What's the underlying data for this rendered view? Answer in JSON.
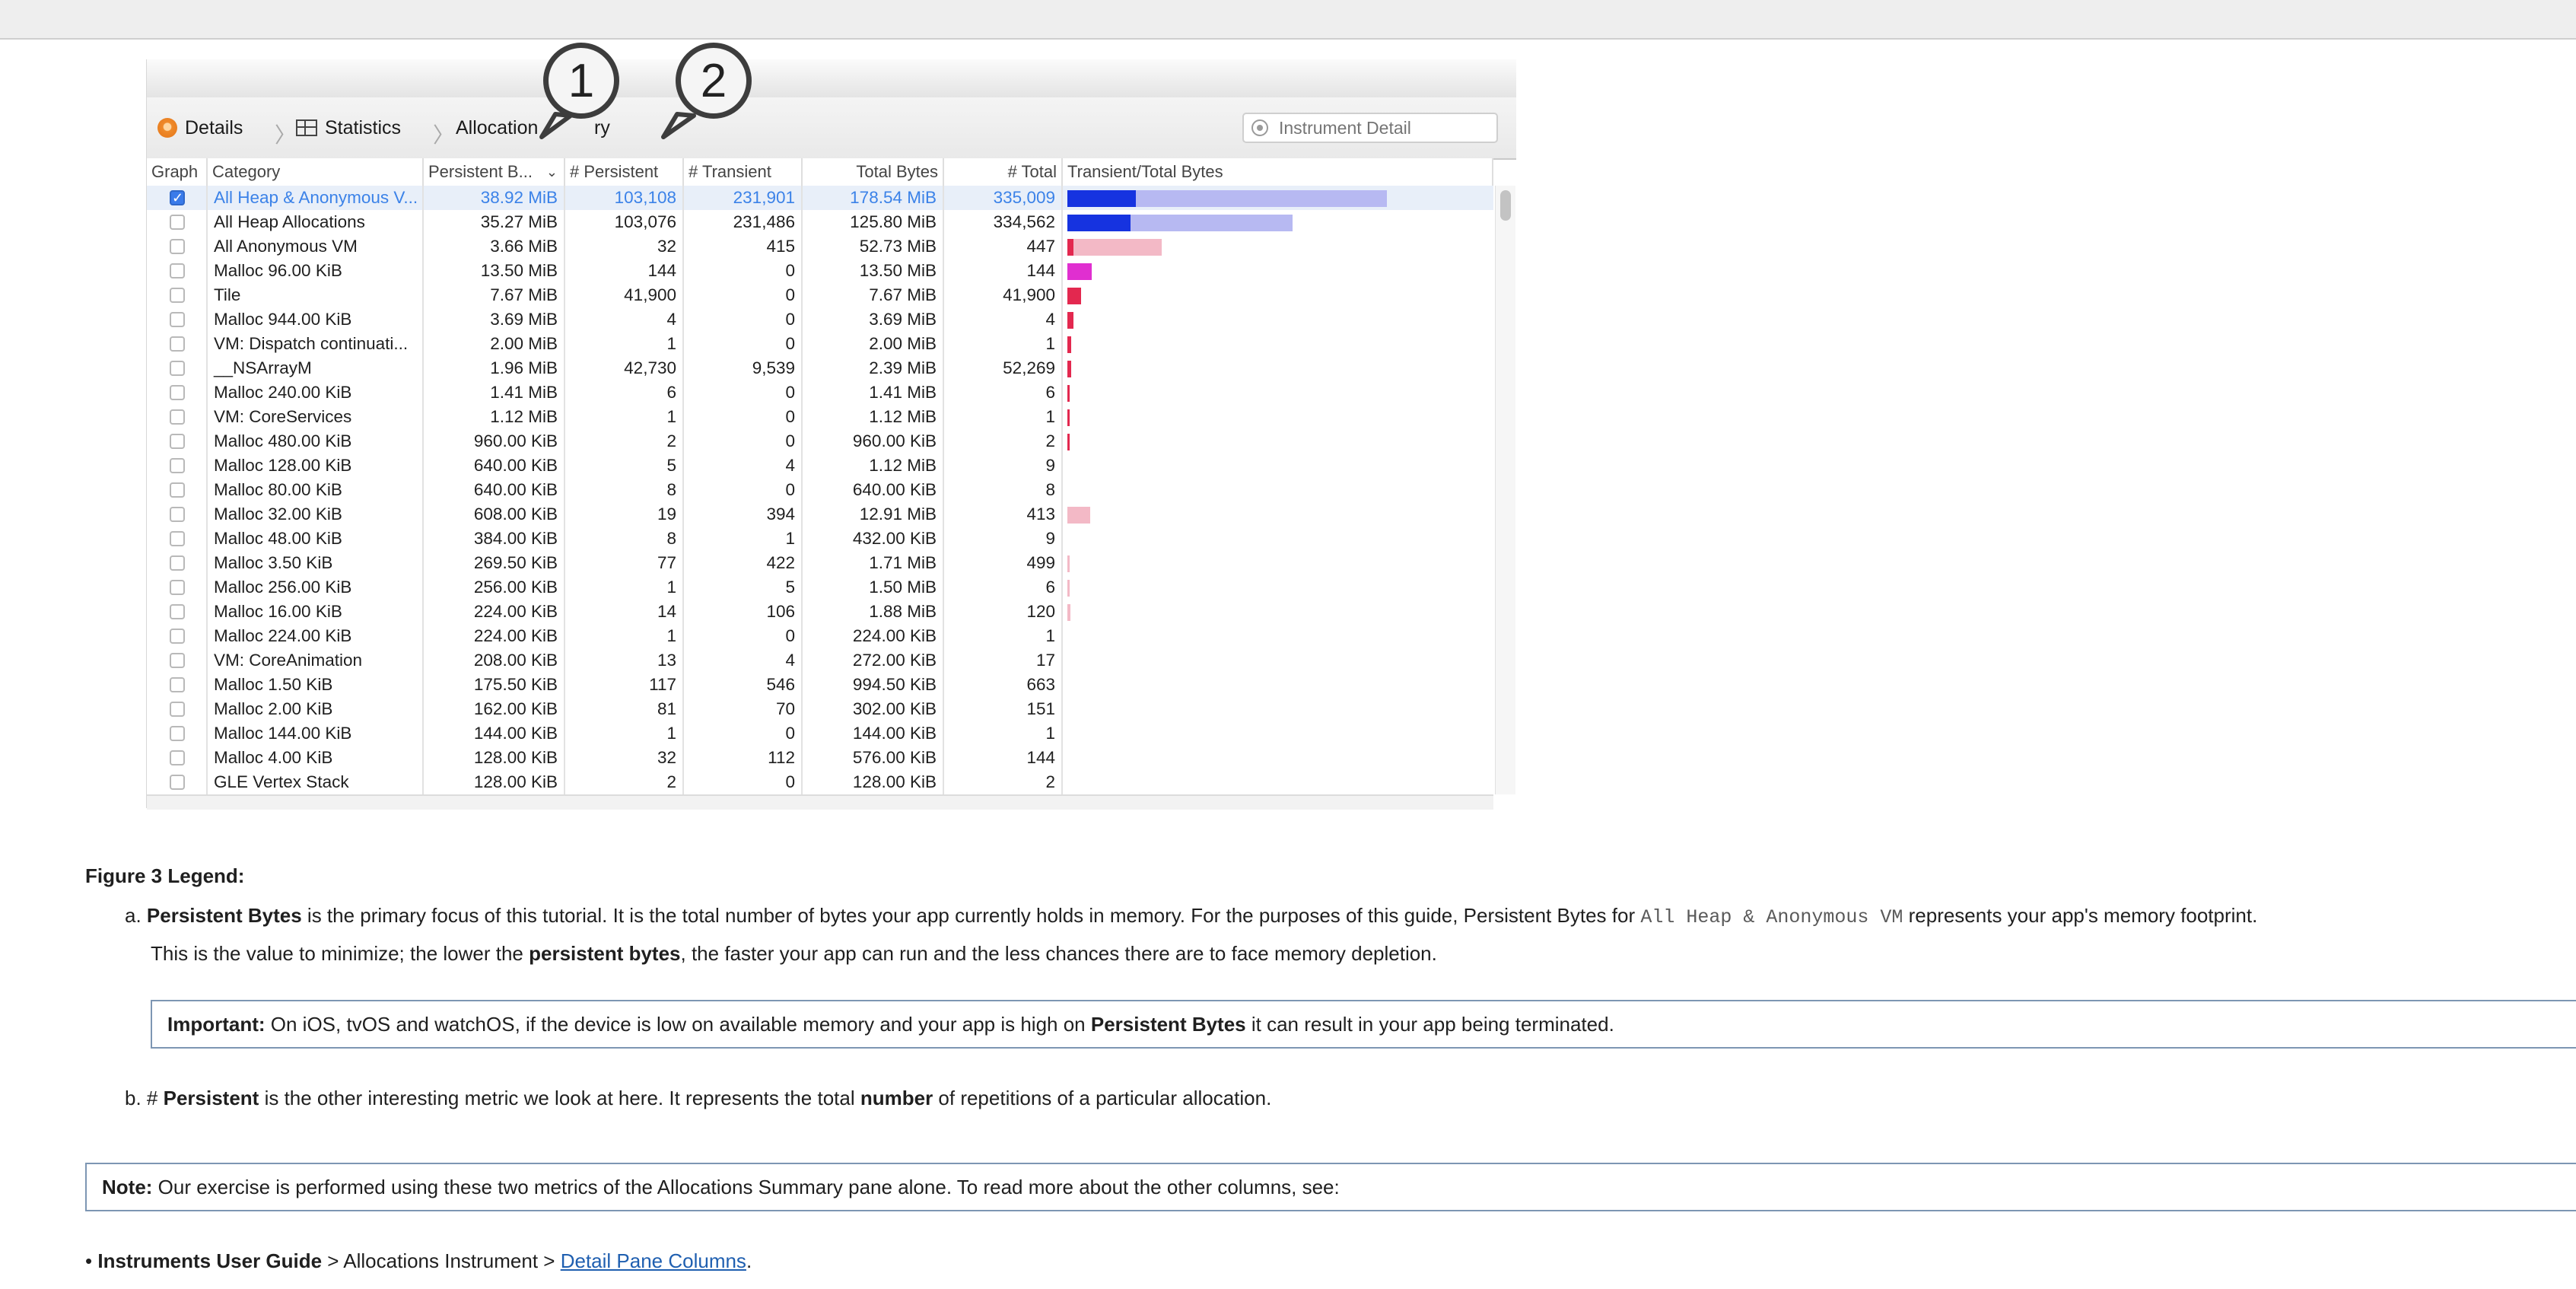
{
  "toolbar": {
    "crumbs": [
      "Details",
      "Statistics",
      "Allocation",
      "ry"
    ],
    "search_placeholder": "Instrument Detail"
  },
  "table": {
    "columns": [
      "Graph",
      "Category",
      "Persistent B...",
      "# Persistent",
      "# Transient",
      "Total Bytes",
      "# Total",
      "Transient/Total Bytes"
    ],
    "rows": [
      {
        "checked": true,
        "selected": true,
        "category": "All Heap & Anonymous V...",
        "persistent_bytes": "38.92 MiB",
        "persistent": "103,108",
        "transient": "231,901",
        "total_bytes": "178.54 MiB",
        "total": "335,009",
        "bar_solid": 0.215,
        "bar_light": 1.0,
        "bar_color": "#1633e0",
        "bar_light_color": "#b7b9f2"
      },
      {
        "checked": false,
        "selected": false,
        "category": "All Heap Allocations",
        "persistent_bytes": "35.27 MiB",
        "persistent": "103,076",
        "transient": "231,486",
        "total_bytes": "125.80 MiB",
        "total": "334,562",
        "bar_solid": 0.197,
        "bar_light": 0.705,
        "bar_color": "#1633e0",
        "bar_light_color": "#b7b9f2"
      },
      {
        "checked": false,
        "selected": false,
        "category": "All Anonymous VM",
        "persistent_bytes": "3.66 MiB",
        "persistent": "32",
        "transient": "415",
        "total_bytes": "52.73 MiB",
        "total": "447",
        "bar_solid": 0.02,
        "bar_light": 0.295,
        "bar_color": "#e3284f",
        "bar_light_color": "#f3b9c6"
      },
      {
        "checked": false,
        "selected": false,
        "category": "Malloc 96.00 KiB",
        "persistent_bytes": "13.50 MiB",
        "persistent": "144",
        "transient": "0",
        "total_bytes": "13.50 MiB",
        "total": "144",
        "bar_solid": 0.075,
        "bar_light": 0.075,
        "bar_color": "#e02fd0",
        "bar_light_color": "#e02fd0"
      },
      {
        "checked": false,
        "selected": false,
        "category": "Tile",
        "persistent_bytes": "7.67 MiB",
        "persistent": "41,900",
        "transient": "0",
        "total_bytes": "7.67 MiB",
        "total": "41,900",
        "bar_solid": 0.043,
        "bar_light": 0.043,
        "bar_color": "#e3284f",
        "bar_light_color": "#e3284f"
      },
      {
        "checked": false,
        "selected": false,
        "category": "Malloc 944.00 KiB",
        "persistent_bytes": "3.69 MiB",
        "persistent": "4",
        "transient": "0",
        "total_bytes": "3.69 MiB",
        "total": "4",
        "bar_solid": 0.02,
        "bar_light": 0.02,
        "bar_color": "#e3284f",
        "bar_light_color": "#e3284f"
      },
      {
        "checked": false,
        "selected": false,
        "category": "VM: Dispatch continuati...",
        "persistent_bytes": "2.00 MiB",
        "persistent": "1",
        "transient": "0",
        "total_bytes": "2.00 MiB",
        "total": "1",
        "bar_solid": 0.011,
        "bar_light": 0.011,
        "bar_color": "#e3284f",
        "bar_light_color": "#e3284f"
      },
      {
        "checked": false,
        "selected": false,
        "category": "__NSArrayM",
        "persistent_bytes": "1.96 MiB",
        "persistent": "42,730",
        "transient": "9,539",
        "total_bytes": "2.39 MiB",
        "total": "52,269",
        "bar_solid": 0.011,
        "bar_light": 0.013,
        "bar_color": "#e3284f",
        "bar_light_color": "#f3b9c6"
      },
      {
        "checked": false,
        "selected": false,
        "category": "Malloc 240.00 KiB",
        "persistent_bytes": "1.41 MiB",
        "persistent": "6",
        "transient": "0",
        "total_bytes": "1.41 MiB",
        "total": "6",
        "bar_solid": 0.008,
        "bar_light": 0.008,
        "bar_color": "#e3284f",
        "bar_light_color": "#e3284f"
      },
      {
        "checked": false,
        "selected": false,
        "category": "VM: CoreServices",
        "persistent_bytes": "1.12 MiB",
        "persistent": "1",
        "transient": "0",
        "total_bytes": "1.12 MiB",
        "total": "1",
        "bar_solid": 0.006,
        "bar_light": 0.006,
        "bar_color": "#e3284f",
        "bar_light_color": "#e3284f"
      },
      {
        "checked": false,
        "selected": false,
        "category": "Malloc 480.00 KiB",
        "persistent_bytes": "960.00 KiB",
        "persistent": "2",
        "transient": "0",
        "total_bytes": "960.00 KiB",
        "total": "2",
        "bar_solid": 0.005,
        "bar_light": 0.005,
        "bar_color": "#e3284f",
        "bar_light_color": "#e3284f"
      },
      {
        "checked": false,
        "selected": false,
        "category": "Malloc 128.00 KiB",
        "persistent_bytes": "640.00 KiB",
        "persistent": "5",
        "transient": "4",
        "total_bytes": "1.12 MiB",
        "total": "9",
        "bar_solid": 0,
        "bar_light": 0,
        "bar_color": "#e3284f",
        "bar_light_color": "#f3b9c6"
      },
      {
        "checked": false,
        "selected": false,
        "category": "Malloc 80.00 KiB",
        "persistent_bytes": "640.00 KiB",
        "persistent": "8",
        "transient": "0",
        "total_bytes": "640.00 KiB",
        "total": "8",
        "bar_solid": 0,
        "bar_light": 0,
        "bar_color": "#e3284f",
        "bar_light_color": "#e3284f"
      },
      {
        "checked": false,
        "selected": false,
        "category": "Malloc 32.00 KiB",
        "persistent_bytes": "608.00 KiB",
        "persistent": "19",
        "transient": "394",
        "total_bytes": "12.91 MiB",
        "total": "413",
        "bar_solid": 0.0,
        "bar_light": 0.072,
        "bar_color": "#e3284f",
        "bar_light_color": "#f3b9c6"
      },
      {
        "checked": false,
        "selected": false,
        "category": "Malloc 48.00 KiB",
        "persistent_bytes": "384.00 KiB",
        "persistent": "8",
        "transient": "1",
        "total_bytes": "432.00 KiB",
        "total": "9",
        "bar_solid": 0,
        "bar_light": 0,
        "bar_color": "#e3284f",
        "bar_light_color": "#f3b9c6"
      },
      {
        "checked": false,
        "selected": false,
        "category": "Malloc 3.50 KiB",
        "persistent_bytes": "269.50 KiB",
        "persistent": "77",
        "transient": "422",
        "total_bytes": "1.71 MiB",
        "total": "499",
        "bar_solid": 0,
        "bar_light": 0.008,
        "bar_color": "#e3284f",
        "bar_light_color": "#f3b9c6"
      },
      {
        "checked": false,
        "selected": false,
        "category": "Malloc 256.00 KiB",
        "persistent_bytes": "256.00 KiB",
        "persistent": "1",
        "transient": "5",
        "total_bytes": "1.50 MiB",
        "total": "6",
        "bar_solid": 0,
        "bar_light": 0.007,
        "bar_color": "#e3284f",
        "bar_light_color": "#f3b9c6"
      },
      {
        "checked": false,
        "selected": false,
        "category": "Malloc 16.00 KiB",
        "persistent_bytes": "224.00 KiB",
        "persistent": "14",
        "transient": "106",
        "total_bytes": "1.88 MiB",
        "total": "120",
        "bar_solid": 0,
        "bar_light": 0.009,
        "bar_color": "#e3284f",
        "bar_light_color": "#f3b9c6"
      },
      {
        "checked": false,
        "selected": false,
        "category": "Malloc 224.00 KiB",
        "persistent_bytes": "224.00 KiB",
        "persistent": "1",
        "transient": "0",
        "total_bytes": "224.00 KiB",
        "total": "1",
        "bar_solid": 0,
        "bar_light": 0,
        "bar_color": "#e3284f",
        "bar_light_color": "#e3284f"
      },
      {
        "checked": false,
        "selected": false,
        "category": "VM: CoreAnimation",
        "persistent_bytes": "208.00 KiB",
        "persistent": "13",
        "transient": "4",
        "total_bytes": "272.00 KiB",
        "total": "17",
        "bar_solid": 0,
        "bar_light": 0,
        "bar_color": "#e3284f",
        "bar_light_color": "#f3b9c6"
      },
      {
        "checked": false,
        "selected": false,
        "category": "Malloc 1.50 KiB",
        "persistent_bytes": "175.50 KiB",
        "persistent": "117",
        "transient": "546",
        "total_bytes": "994.50 KiB",
        "total": "663",
        "bar_solid": 0,
        "bar_light": 0,
        "bar_color": "#e3284f",
        "bar_light_color": "#f3b9c6"
      },
      {
        "checked": false,
        "selected": false,
        "category": "Malloc 2.00 KiB",
        "persistent_bytes": "162.00 KiB",
        "persistent": "81",
        "transient": "70",
        "total_bytes": "302.00 KiB",
        "total": "151",
        "bar_solid": 0,
        "bar_light": 0,
        "bar_color": "#e3284f",
        "bar_light_color": "#f3b9c6"
      },
      {
        "checked": false,
        "selected": false,
        "category": "Malloc 144.00 KiB",
        "persistent_bytes": "144.00 KiB",
        "persistent": "1",
        "transient": "0",
        "total_bytes": "144.00 KiB",
        "total": "1",
        "bar_solid": 0,
        "bar_light": 0,
        "bar_color": "#e3284f",
        "bar_light_color": "#e3284f"
      },
      {
        "checked": false,
        "selected": false,
        "category": "Malloc 4.00 KiB",
        "persistent_bytes": "128.00 KiB",
        "persistent": "32",
        "transient": "112",
        "total_bytes": "576.00 KiB",
        "total": "144",
        "bar_solid": 0,
        "bar_light": 0,
        "bar_color": "#e3284f",
        "bar_light_color": "#f3b9c6"
      },
      {
        "checked": false,
        "selected": false,
        "category": "GLE Vertex Stack",
        "persistent_bytes": "128.00 KiB",
        "persistent": "2",
        "transient": "0",
        "total_bytes": "128.00 KiB",
        "total": "2",
        "bar_solid": 0,
        "bar_light": 0,
        "bar_color": "#e3284f",
        "bar_light_color": "#e3284f"
      }
    ]
  },
  "callouts": [
    "1",
    "2"
  ],
  "doc": {
    "legend_title": "Figure 3 Legend:",
    "item_a": {
      "marker": "a.",
      "term": "Persistent Bytes",
      "text1": " is the primary focus of this tutorial. It is the total number of bytes your app currently holds in memory. For the purposes of this guide, Persistent Bytes for ",
      "code": "All Heap & Anonymous VM",
      "text2": " represents your app's memory footprint.",
      "line2_pre": "This is the value to minimize; the lower the ",
      "line2_bold": "persistent bytes",
      "line2_post": ", the faster your app can run and the less chances there are to face memory depletion."
    },
    "important": {
      "label": "Important:",
      "pre": " On iOS, tvOS and watchOS, if the device is low on available memory and your app is high on ",
      "bold": "Persistent Bytes",
      "post": " it can result in your app being terminated."
    },
    "item_b": {
      "marker": "b.",
      "pre": "# ",
      "term": "Persistent",
      "mid": " is the other interesting metric we look at here. It represents the total ",
      "bold2": "number",
      "post": " of repetitions of a particular allocation."
    },
    "note": {
      "label": "Note:",
      "text": " Our exercise is performed using these two metrics of the Allocations Summary pane alone. To read more about the other columns, see:"
    },
    "bullet": {
      "marker": "•",
      "bold": "Instruments User Guide",
      "mid": " > Allocations Instrument > ",
      "link": "Detail Pane Columns",
      "end": "."
    }
  }
}
